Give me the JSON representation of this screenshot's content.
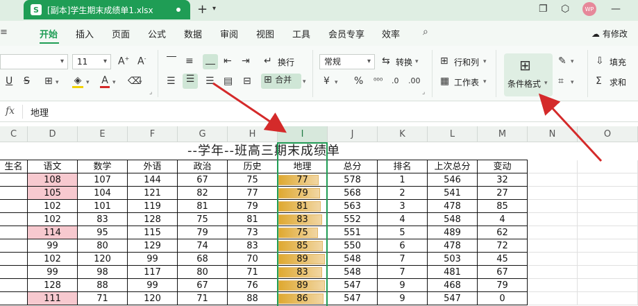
{
  "titlebar": {
    "app_icon": "S",
    "file_title": "[副本]学生期末成绩单1.xlsx",
    "avatar_text": "WP"
  },
  "menu": [
    "开始",
    "插入",
    "页面",
    "公式",
    "数据",
    "审阅",
    "视图",
    "工具",
    "会员专享",
    "效率"
  ],
  "menu_active": "开始",
  "menu_edit": "有修改",
  "ribbon": {
    "font_size": "11",
    "wrap_label": "换行",
    "merge_label": "合并",
    "number_format": "常规",
    "convert_label": "转换",
    "row_col_label": "行和列",
    "sheet_label": "工作表",
    "cond_format_label": "条件格式",
    "fill_label": "填充",
    "sum_label": "求和"
  },
  "formula": {
    "value": "地理"
  },
  "columns": [
    "C",
    "D",
    "E",
    "F",
    "G",
    "H",
    "I",
    "J",
    "K",
    "L",
    "M",
    "N",
    "O"
  ],
  "selected_column": "I",
  "sheet_title": "--学年--班高三期末成绩单",
  "headers": [
    "生名",
    "语文",
    "数学",
    "外语",
    "政治",
    "历史",
    "地理",
    "总分",
    "排名",
    "上次总分",
    "变动"
  ],
  "rows": [
    {
      "yuwen": "108",
      "shuxue": "107",
      "waiyu": "144",
      "zhengzhi": "67",
      "lishi": "75",
      "dili": "77",
      "zongfen": "578",
      "paiming": "1",
      "shangci": "546",
      "biandong": "32",
      "pink": true
    },
    {
      "yuwen": "105",
      "shuxue": "104",
      "waiyu": "121",
      "zhengzhi": "82",
      "lishi": "77",
      "dili": "79",
      "zongfen": "568",
      "paiming": "2",
      "shangci": "541",
      "biandong": "27",
      "pink": true
    },
    {
      "yuwen": "102",
      "shuxue": "101",
      "waiyu": "119",
      "zhengzhi": "81",
      "lishi": "79",
      "dili": "81",
      "zongfen": "563",
      "paiming": "3",
      "shangci": "478",
      "biandong": "85",
      "pink": false
    },
    {
      "yuwen": "102",
      "shuxue": "83",
      "waiyu": "128",
      "zhengzhi": "75",
      "lishi": "81",
      "dili": "83",
      "zongfen": "552",
      "paiming": "4",
      "shangci": "548",
      "biandong": "4",
      "pink": false
    },
    {
      "yuwen": "114",
      "shuxue": "95",
      "waiyu": "115",
      "zhengzhi": "79",
      "lishi": "73",
      "dili": "75",
      "zongfen": "551",
      "paiming": "5",
      "shangci": "489",
      "biandong": "62",
      "pink": true
    },
    {
      "yuwen": "99",
      "shuxue": "80",
      "waiyu": "129",
      "zhengzhi": "74",
      "lishi": "83",
      "dili": "85",
      "zongfen": "550",
      "paiming": "6",
      "shangci": "478",
      "biandong": "72",
      "pink": false
    },
    {
      "yuwen": "102",
      "shuxue": "120",
      "waiyu": "99",
      "zhengzhi": "68",
      "lishi": "70",
      "dili": "89",
      "zongfen": "548",
      "paiming": "7",
      "shangci": "503",
      "biandong": "45",
      "pink": false
    },
    {
      "yuwen": "99",
      "shuxue": "98",
      "waiyu": "117",
      "zhengzhi": "80",
      "lishi": "71",
      "dili": "83",
      "zongfen": "548",
      "paiming": "7",
      "shangci": "481",
      "biandong": "67",
      "pink": false
    },
    {
      "yuwen": "128",
      "shuxue": "88",
      "waiyu": "99",
      "zhengzhi": "67",
      "lishi": "76",
      "dili": "89",
      "zongfen": "547",
      "paiming": "9",
      "shangci": "468",
      "biandong": "79",
      "pink": false
    },
    {
      "yuwen": "111",
      "shuxue": "71",
      "waiyu": "120",
      "zhengzhi": "71",
      "lishi": "88",
      "dili": "86",
      "zongfen": "547",
      "paiming": "9",
      "shangci": "547",
      "biandong": "0",
      "pink": true
    }
  ],
  "databar_range": [
    0,
    90
  ],
  "colors": {
    "accent": "#1f9d55",
    "pink_fill": "#f7c9cf",
    "databar": "#dfa931",
    "arrow": "#d42a2a"
  }
}
